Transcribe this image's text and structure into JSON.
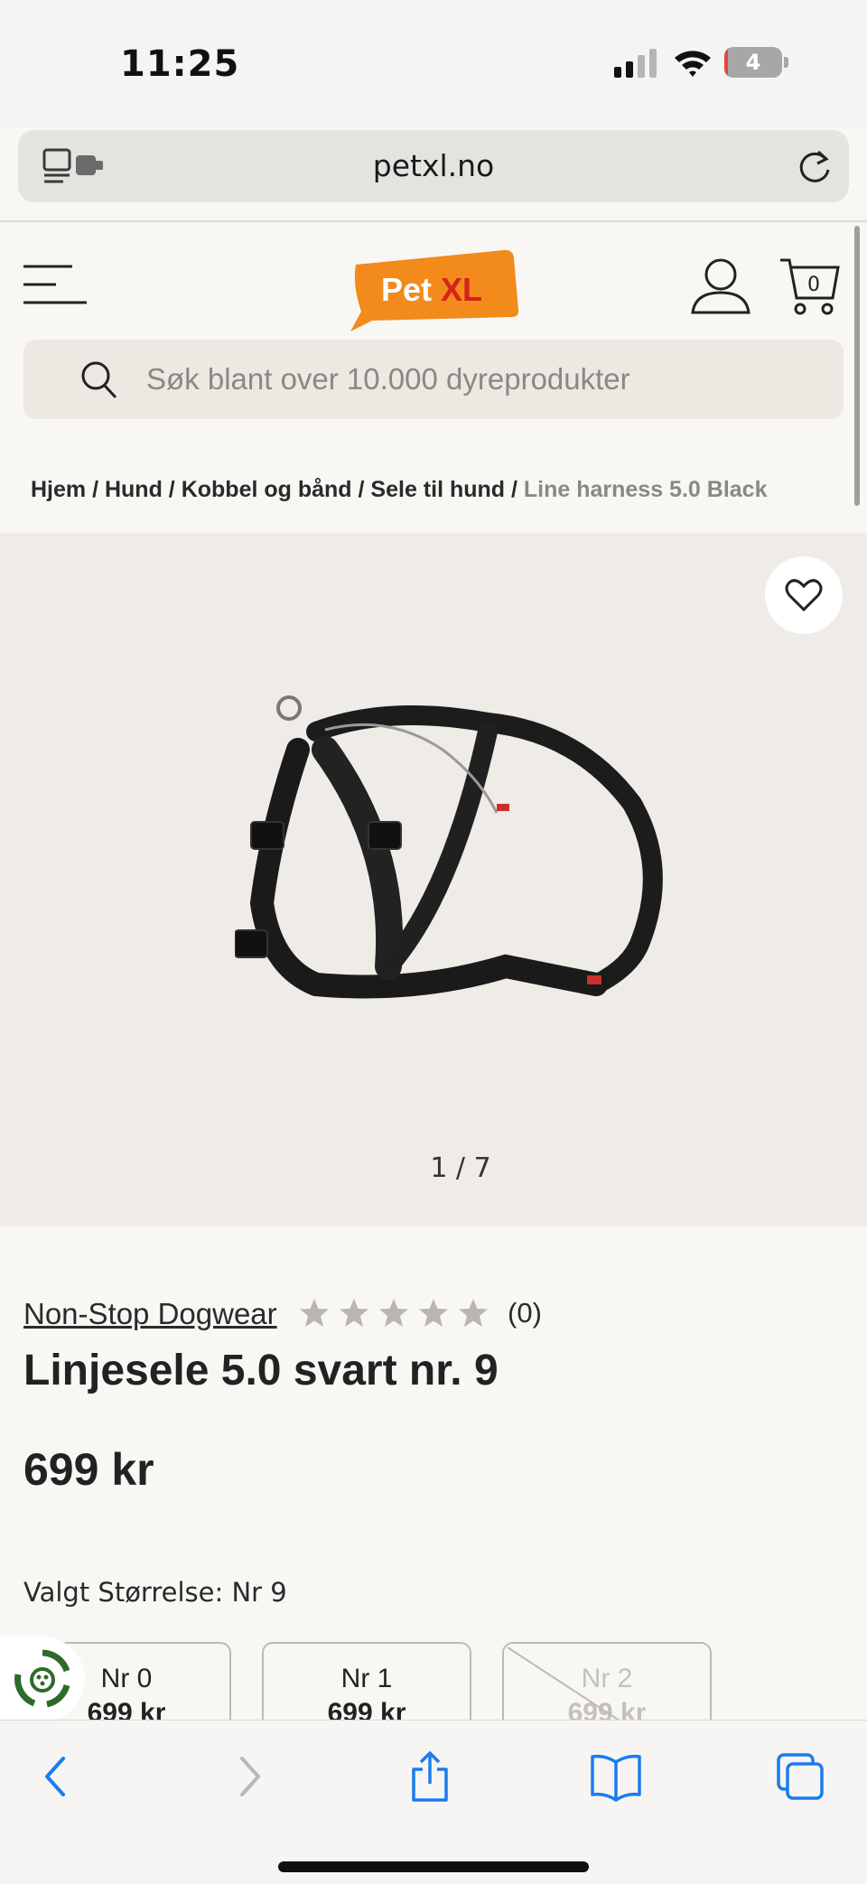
{
  "status_bar": {
    "time": "11:25",
    "battery_level": "4",
    "battery_fraction": 0.04
  },
  "browser": {
    "url": "petxl.no"
  },
  "header": {
    "logo_text_1": "Pet",
    "logo_text_2": "XL",
    "cart_count": "0",
    "search_placeholder": "Søk blant over 10.000 dyreprodukter"
  },
  "breadcrumb": {
    "items": [
      "Hjem",
      "Hund",
      "Kobbel og bånd",
      "Sele til hund"
    ],
    "separator": " / ",
    "current": "Line harness 5.0 Black"
  },
  "gallery": {
    "counter": "1 / 7"
  },
  "product": {
    "brand": "Non-Stop Dogwear",
    "rating_stars": 0,
    "rating_max": 5,
    "rating_count": "(0)",
    "title": "Linjesele 5.0 svart nr. 9",
    "price": "699 kr",
    "selected_size_label": "Valgt Størrelse: Nr 9",
    "sizes": [
      {
        "name": "Nr 0",
        "price": "699 kr",
        "available": true
      },
      {
        "name": "Nr 1",
        "price": "699 kr",
        "available": true
      },
      {
        "name": "Nr 2",
        "price": "699 kr",
        "available": false
      }
    ]
  },
  "colors": {
    "logo_orange": "#f28a1c",
    "star_empty": "#b9b6b1",
    "ios_blue": "#1a7cf0",
    "chat_green": "#2e6b2a"
  }
}
